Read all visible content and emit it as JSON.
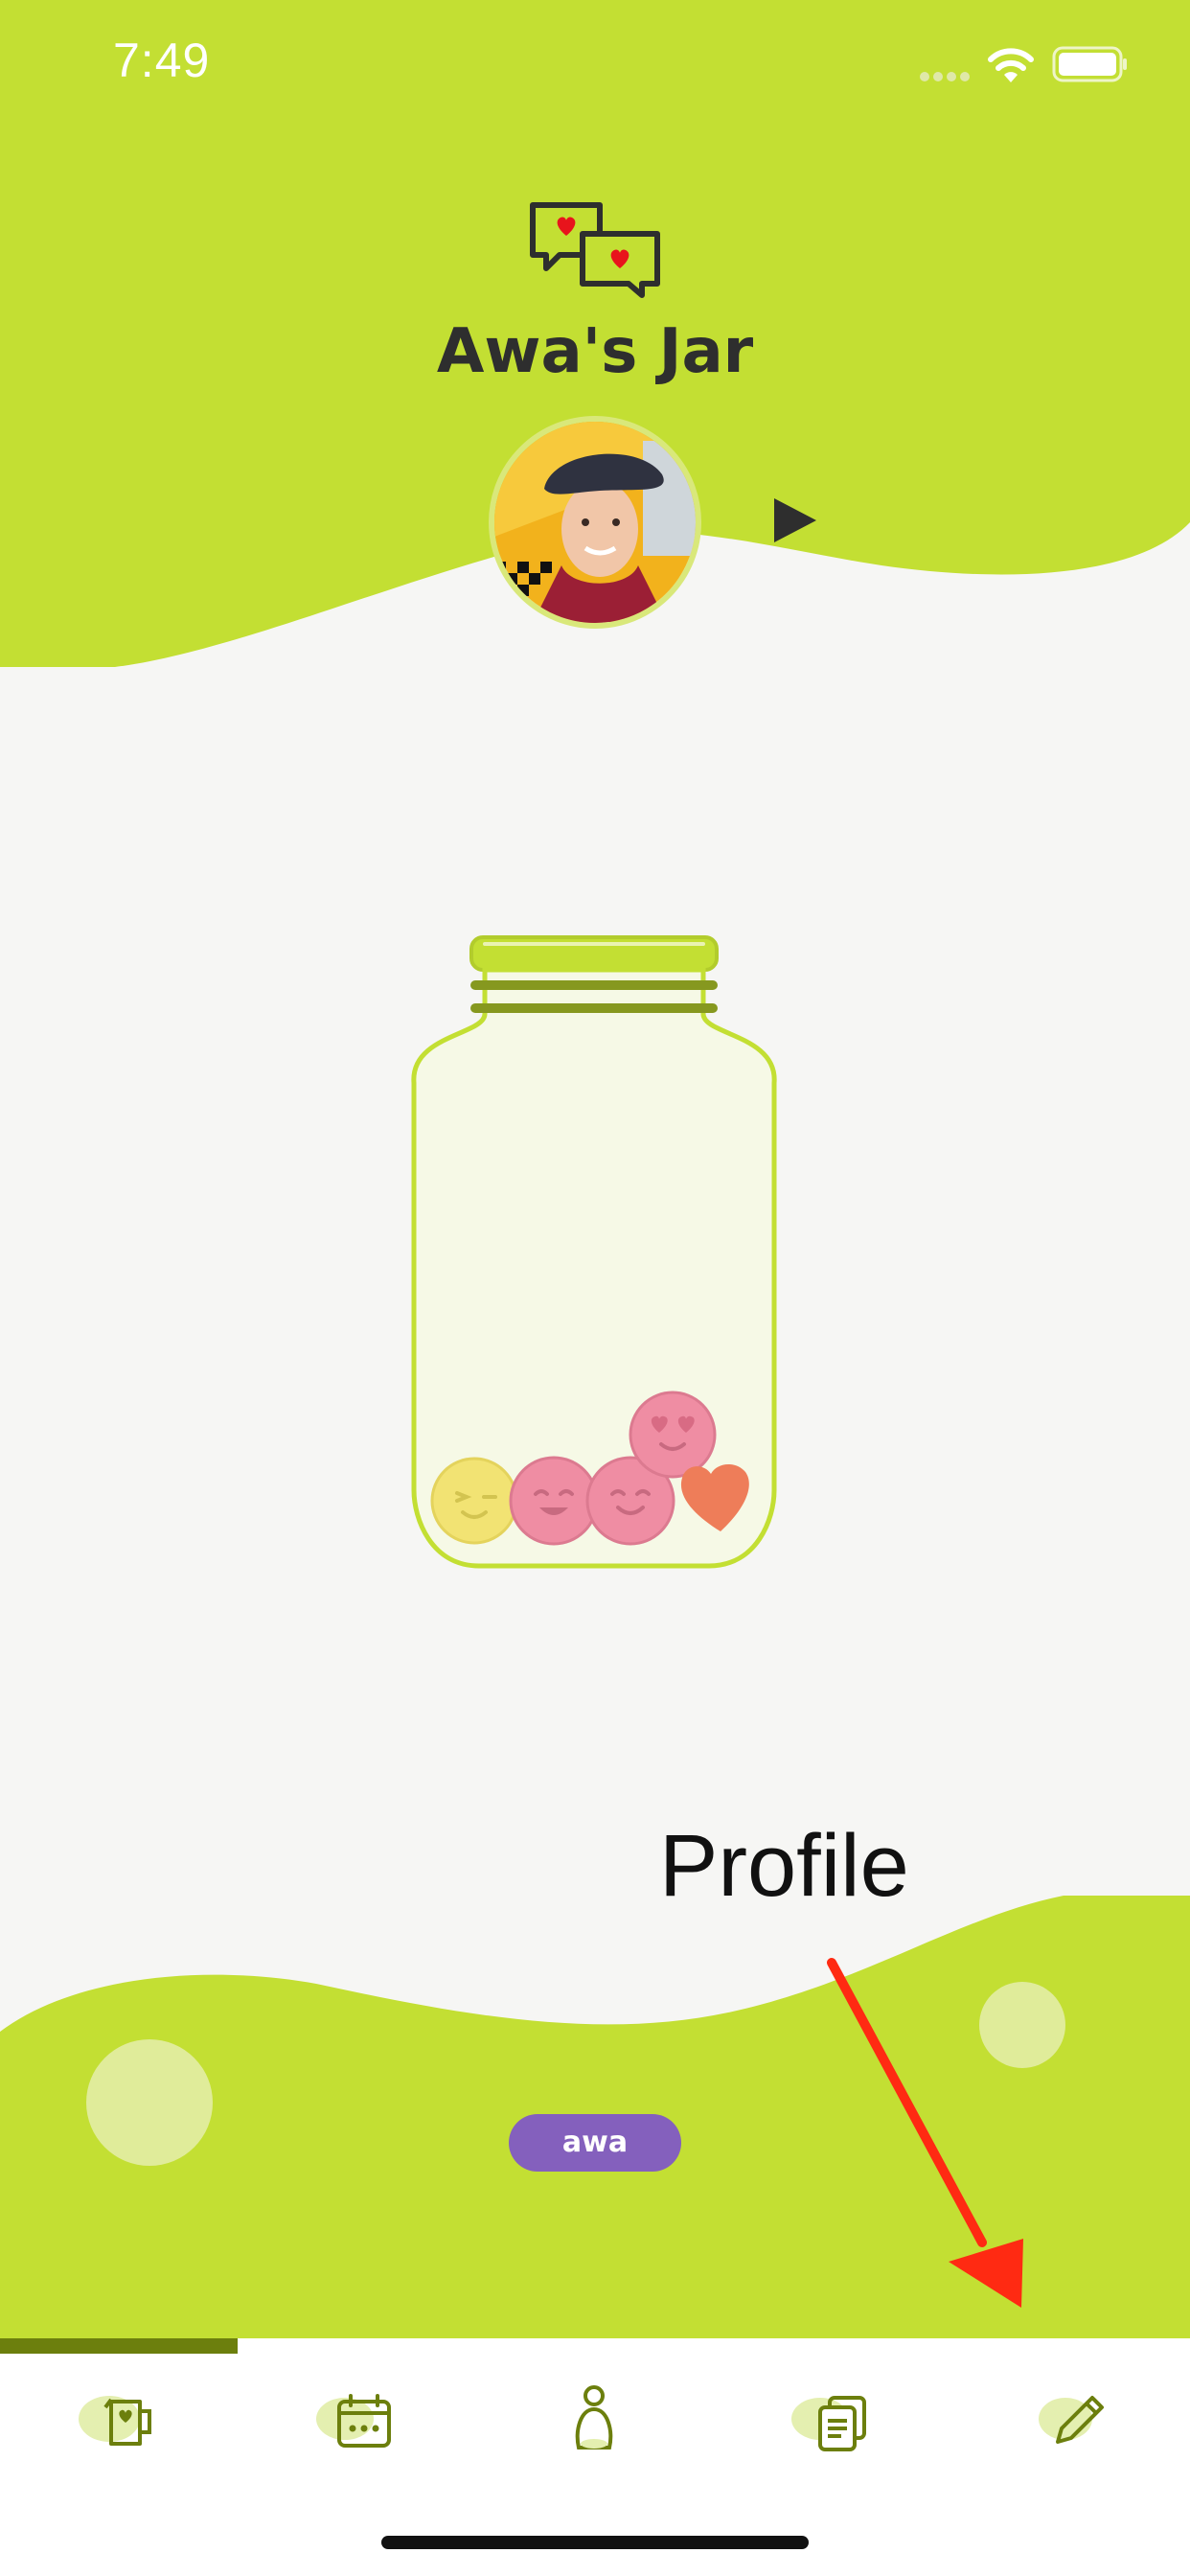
{
  "status_bar": {
    "time": "7:49"
  },
  "header": {
    "title": "Awa's Jar"
  },
  "profile": {
    "name": "awa"
  },
  "annotation": {
    "label": "Profile"
  },
  "colors": {
    "primary": "#c3df33",
    "accent": "#8460bd",
    "tab_active": "#6c7f0d",
    "arrow": "#ff2a12"
  },
  "jar": {
    "items": [
      {
        "type": "emoji-wink",
        "color": "yellow"
      },
      {
        "type": "emoji-smile",
        "color": "pink"
      },
      {
        "type": "emoji-smile",
        "color": "pink"
      },
      {
        "type": "emoji-heart-eyes",
        "color": "pink"
      },
      {
        "type": "heart",
        "color": "orange"
      }
    ]
  },
  "tabs": [
    {
      "icon": "jar-mug-icon",
      "active": true
    },
    {
      "icon": "calendar-icon",
      "active": false
    },
    {
      "icon": "person-icon",
      "active": false
    },
    {
      "icon": "documents-icon",
      "active": false
    },
    {
      "icon": "pencil-icon",
      "active": false
    }
  ]
}
